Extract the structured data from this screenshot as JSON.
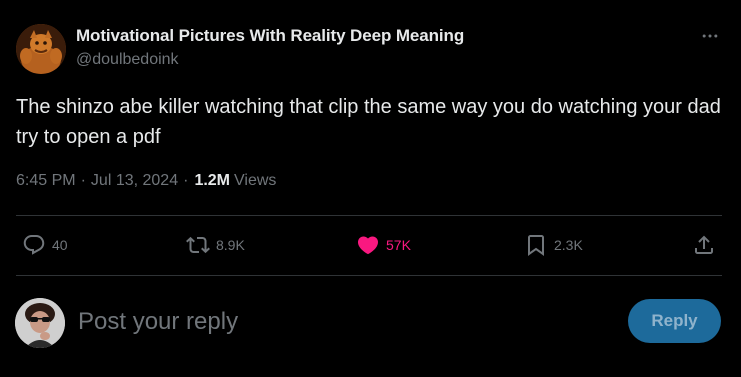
{
  "author": {
    "name": "Motivational Pictures With Reality Deep Meaning",
    "handle": "@doulbedoink"
  },
  "tweet": {
    "text": "The shinzo abe killer watching that clip the same way you do watching your dad try to open a pdf",
    "time": "6:45 PM",
    "date": "Jul 13, 2024",
    "separator": "·",
    "views_count": "1.2M",
    "views_label": "Views"
  },
  "actions": {
    "replies": "40",
    "reposts": "8.9K",
    "likes": "57K",
    "bookmarks": "2.3K"
  },
  "icons": {
    "more": "more-icon",
    "reply": "reply-icon",
    "repost": "repost-icon",
    "like": "heart-icon",
    "bookmark": "bookmark-icon",
    "share": "share-icon"
  },
  "composer": {
    "placeholder": "Post your reply",
    "button_label": "Reply"
  },
  "colors": {
    "background": "#000000",
    "text_primary": "#e7e9ea",
    "text_secondary": "#71767b",
    "like_active": "#f91880",
    "reply_button_bg": "#1d6a9b",
    "divider": "#2f3336"
  }
}
